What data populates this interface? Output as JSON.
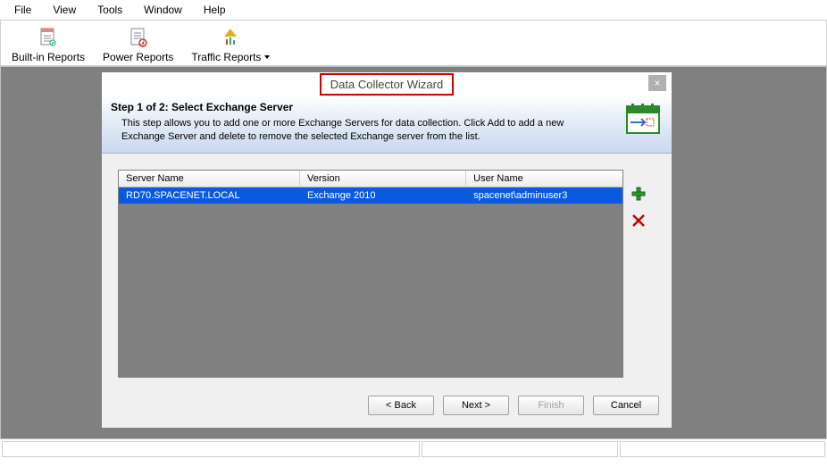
{
  "menu": {
    "file": "File",
    "view": "View",
    "tools": "Tools",
    "window": "Window",
    "help": "Help"
  },
  "toolbar": {
    "builtin": "Built-in Reports",
    "power": "Power Reports",
    "traffic": "Traffic Reports"
  },
  "dialog": {
    "title": "Data Collector Wizard",
    "close": "×",
    "step_title": "Step 1 of 2:  Select Exchange Server",
    "step_desc": "This step allows you to add one or more Exchange Servers for data collection. Click Add to add a new Exchange Server and delete to remove the selected Exchange server from the list.",
    "columns": {
      "server": "Server Name",
      "version": "Version",
      "user": "User Name"
    },
    "rows": [
      {
        "server": "RD70.SPACENET.LOCAL",
        "version": "Exchange 2010",
        "user": "spacenet\\adminuser3"
      }
    ],
    "buttons": {
      "back": "< Back",
      "next": "Next >",
      "finish": "Finish",
      "cancel": "Cancel"
    }
  }
}
